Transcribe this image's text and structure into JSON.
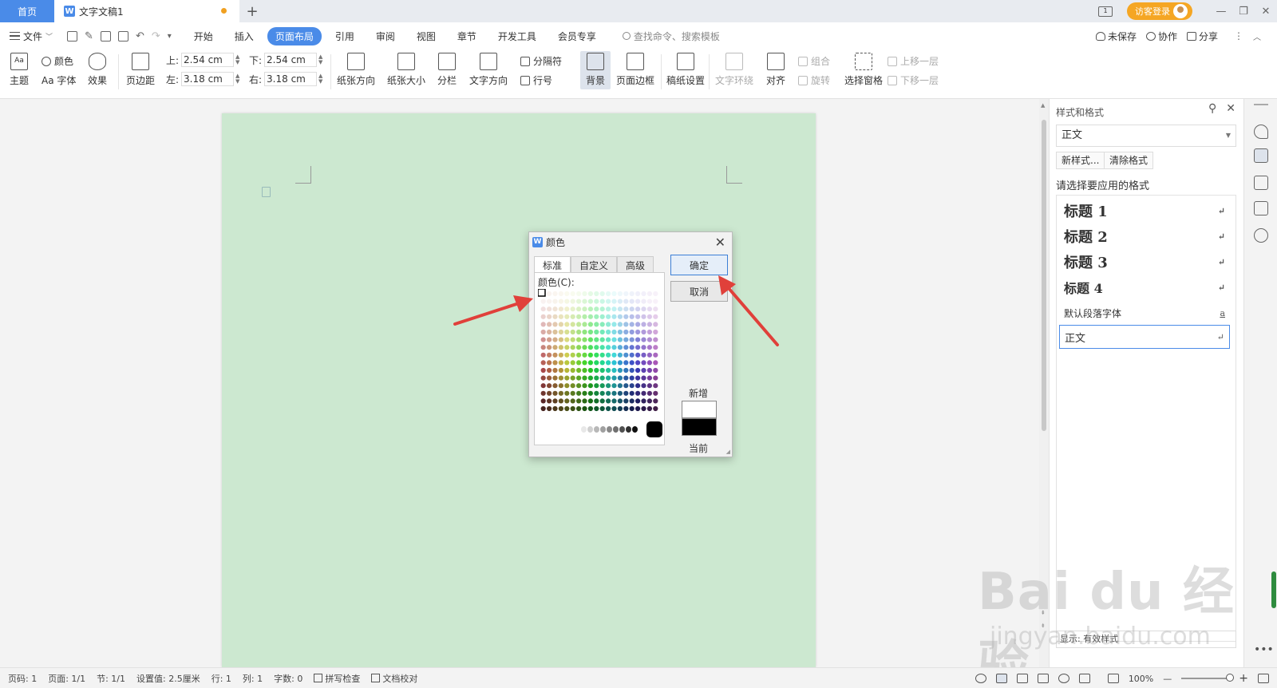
{
  "titlebar": {
    "home_tab": "首页",
    "doc_tab": "文字文稿1",
    "doc_icon": "W",
    "new_tab": "+",
    "page_indicator": "1",
    "login_label": "访客登录",
    "minimize": "—",
    "restore": "❐",
    "close": "✕"
  },
  "menubar": {
    "file": "文件",
    "tabs": [
      "开始",
      "插入",
      "页面布局",
      "引用",
      "审阅",
      "视图",
      "章节",
      "开发工具",
      "会员专享"
    ],
    "active_tab": "页面布局",
    "search_placeholder": "查找命令、搜索模板",
    "unsaved": "未保存",
    "collab": "协作",
    "share": "分享"
  },
  "ribbon": {
    "theme": "主题",
    "color": "颜色",
    "font": "Aa 字体",
    "effect": "效果",
    "margins": "页边距",
    "top_label": "上:",
    "top_value": "2.54 cm",
    "bottom_label": "下:",
    "bottom_value": "2.54 cm",
    "left_label": "左:",
    "left_value": "3.18 cm",
    "right_label": "右:",
    "right_value": "3.18 cm",
    "orientation": "纸张方向",
    "size": "纸张大小",
    "columns": "分栏",
    "text_direction": "文字方向",
    "separator": "分隔符",
    "line_number": "行号",
    "background": "背景",
    "page_border": "页面边框",
    "draft_setting": "稿纸设置",
    "text_wrap": "文字环绕",
    "align": "对齐",
    "group": "组合",
    "rotate": "旋转",
    "selection_pane": "选择窗格",
    "bring_forward": "上移一层",
    "send_backward": "下移一层"
  },
  "dialog": {
    "icon": "W",
    "title": "颜色",
    "tabs": [
      "标准",
      "自定义",
      "高级"
    ],
    "active_tab": "标准",
    "colors_label": "颜色(C):",
    "ok": "确定",
    "cancel": "取消",
    "new_label": "新增",
    "current_label": "当前",
    "new_color": "#ffffff",
    "current_color": "#000000"
  },
  "style_pane": {
    "title": "样式和格式",
    "current_style": "正文",
    "new_style": "新样式...",
    "clear_format": "清除格式",
    "prompt": "请选择要应用的格式",
    "items": [
      {
        "label": "标题  1",
        "mark": "↵"
      },
      {
        "label": "标题  2",
        "mark": "↵"
      },
      {
        "label": "标题  3",
        "mark": "↵"
      },
      {
        "label": "标题  4",
        "mark": "↵"
      },
      {
        "label": "默认段落字体",
        "mark": "a"
      },
      {
        "label": "正文",
        "mark": "↵"
      }
    ],
    "selected_item": "正文",
    "show_label": "显示: 有效样式"
  },
  "watermark": {
    "main": "Bai du 经验",
    "sub": "jingyan.baidu.com"
  },
  "statusbar": {
    "page_num": "页码: 1",
    "pages": "页面: 1/1",
    "section": "节: 1/1",
    "setting": "设置值: 2.5厘米",
    "row": "行: 1",
    "col": "列: 1",
    "word_count": "字数: 0",
    "spell_check": "拼写检查",
    "doc_proof": "文档校对",
    "zoom": "100%",
    "zoom_minus": "—",
    "zoom_plus": "+"
  },
  "colors": {
    "accent": "#4a8be8",
    "page_bg": "#cce8d0",
    "arrow": "#e0403a",
    "login": "#f5a623"
  }
}
